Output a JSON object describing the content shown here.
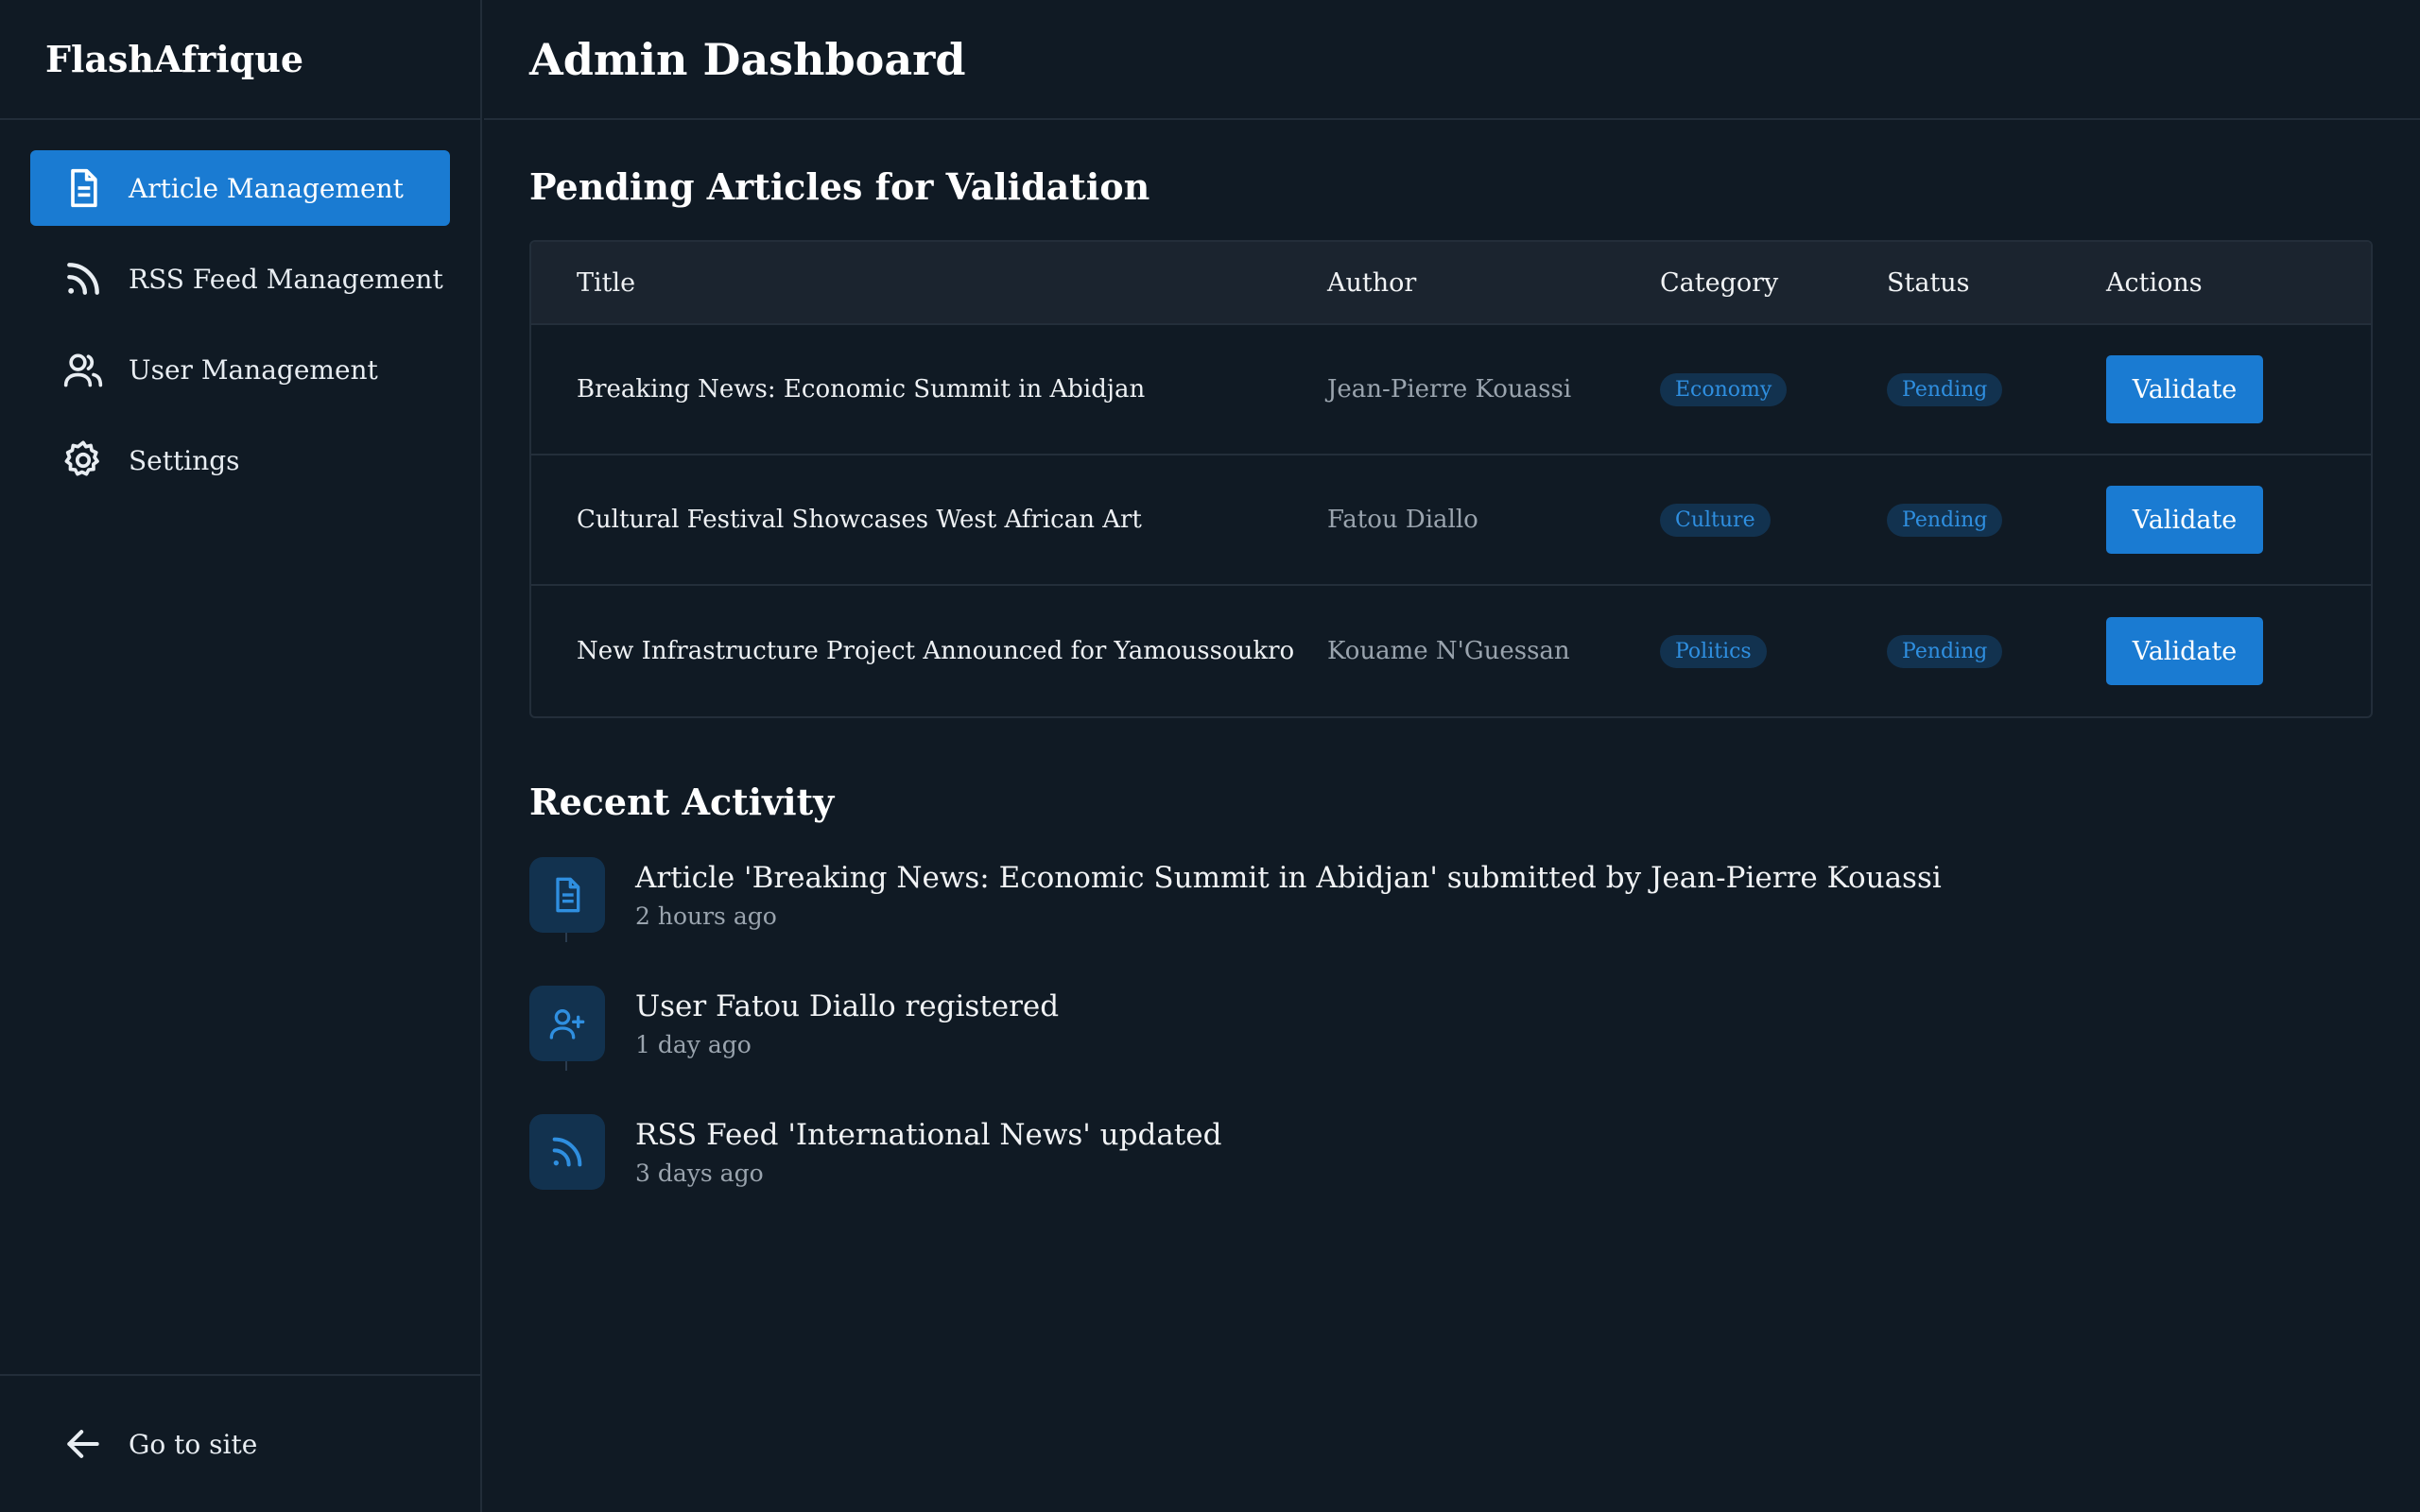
{
  "app": {
    "brand": "FlashAfrique"
  },
  "sidebar": {
    "items": [
      {
        "label": "Article Management",
        "icon": "document-icon",
        "active": true
      },
      {
        "label": "RSS Feed Management",
        "icon": "rss-icon",
        "active": false
      },
      {
        "label": "User Management",
        "icon": "users-icon",
        "active": false
      },
      {
        "label": "Settings",
        "icon": "gear-icon",
        "active": false
      }
    ],
    "footer": {
      "label": "Go to site",
      "icon": "arrow-left-icon"
    }
  },
  "header": {
    "title": "Admin Dashboard"
  },
  "pending": {
    "title": "Pending Articles for Validation",
    "columns": [
      "Title",
      "Author",
      "Category",
      "Status",
      "Actions"
    ],
    "rows": [
      {
        "title": "Breaking News: Economic Summit in Abidjan",
        "author": "Jean-Pierre Kouassi",
        "category": "Economy",
        "status": "Pending",
        "action": "Validate"
      },
      {
        "title": "Cultural Festival Showcases West African Art",
        "author": "Fatou Diallo",
        "category": "Culture",
        "status": "Pending",
        "action": "Validate"
      },
      {
        "title": "New Infrastructure Project Announced for Yamoussoukro",
        "author": "Kouame N'Guessan",
        "category": "Politics",
        "status": "Pending",
        "action": "Validate"
      }
    ]
  },
  "activity": {
    "title": "Recent Activity",
    "items": [
      {
        "icon": "document-icon",
        "message": "Article 'Breaking News: Economic Summit in Abidjan' submitted by Jean-Pierre Kouassi",
        "time": "2 hours ago"
      },
      {
        "icon": "user-plus-icon",
        "message": "User Fatou Diallo registered",
        "time": "1 day ago"
      },
      {
        "icon": "rss-icon",
        "message": "RSS Feed 'International News' updated",
        "time": "3 days ago"
      }
    ]
  },
  "colors": {
    "accent": "#1a7bd2",
    "background": "#101a24",
    "badge_bg": "#12324f",
    "badge_text": "#2f8fe0"
  }
}
